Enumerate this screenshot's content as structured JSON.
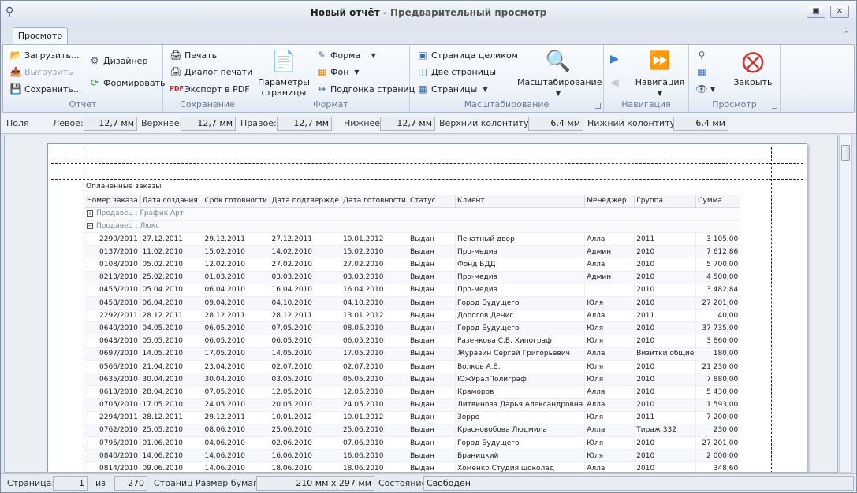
{
  "window": {
    "title": "Новый отчёт",
    "subtitle": " - Предварительный просмотр"
  },
  "tabs": [
    {
      "label": "Просмотр"
    }
  ],
  "ribbon": {
    "report": {
      "title": "Отчет",
      "load": "Загрузить...",
      "unload": "Выгрузить",
      "save": "Сохранить...",
      "designer": "Дизайнер",
      "build": "Формировать"
    },
    "save_group": {
      "title": "Сохранение",
      "print": "Печать",
      "print_dialog": "Диалог печати",
      "export_pdf": "Экспорт в PDF"
    },
    "format": {
      "title": "Формат",
      "page_params": "Параметры страницы",
      "format": "Формат",
      "background": "Фон",
      "fit_pages": "Подгонка страниц"
    },
    "zoom": {
      "title": "Масштабирование",
      "whole_page": "Страница целиком",
      "two_pages": "Две страницы",
      "pages": "Страницы",
      "zoom": "Масштабирование"
    },
    "nav": {
      "title": "Навигация",
      "navigation": "Навигация"
    },
    "view": {
      "title": "Просмотр",
      "close": "Закрыть"
    }
  },
  "margins": {
    "label": "Поля",
    "left_label": "Левое:",
    "left": "12,7 мм",
    "top_label": "Верхнее:",
    "top": "12,7 мм",
    "right_label": "Правое:",
    "right": "12,7 мм",
    "bottom_label": "Нижнее:",
    "bottom": "12,7 мм",
    "header_label": "Верхний колонтитул:",
    "header": "6,4 мм",
    "footer_label": "Нижний колонтитул:",
    "footer": "6,4 мм"
  },
  "report": {
    "title": "Оплаченные заказы",
    "columns": [
      "Номер заказа",
      "Дата создания",
      "Срок готовности",
      "Дата подтвержде",
      "Дата готовности",
      "Статус",
      "Клиент",
      "Менеджер",
      "Группа",
      "Сумма"
    ],
    "group1": "Продавец : График Арт",
    "group2": "Продавец : Люкс",
    "rows": [
      [
        "2290/2011",
        "27.12.2011",
        "29.12.2011",
        "27.12.2011",
        "10.01.2012",
        "Выдан",
        "Печатный двор",
        "Алла",
        "2011",
        "3 105,00"
      ],
      [
        "0137/2010",
        "11.02.2010",
        "15.02.2010",
        "14.02.2010",
        "15.02.2010",
        "Выдан",
        "Про-медиа",
        "Админ",
        "2010",
        "7 612,86"
      ],
      [
        "0108/2010",
        "05.02.2010",
        "12.02.2010",
        "27.02.2010",
        "27.02.2010",
        "Выдан",
        "Фонд БДД",
        "Алла",
        "2010",
        "5 700,00"
      ],
      [
        "0213/2010",
        "25.02.2010",
        "01.03.2010",
        "03.03.2010",
        "03.03.2010",
        "Выдан",
        "Про-медиа",
        "Админ",
        "2010",
        "4 500,00"
      ],
      [
        "0455/2010",
        "05.04.2010",
        "06.04.2010",
        "16.04.2010",
        "16.04.2010",
        "Выдан",
        "Про-медиа",
        "",
        "2010",
        "3 482,84"
      ],
      [
        "0458/2010",
        "06.04.2010",
        "09.04.2010",
        "04.10.2010",
        "04.10.2010",
        "Выдан",
        "Город Будущего",
        "Юля",
        "2010",
        "27 201,00"
      ],
      [
        "2292/2011",
        "28.12.2011",
        "28.12.2011",
        "28.12.2011",
        "13.01.2012",
        "Выдан",
        "Дорогов Денис",
        "Алла",
        "2011",
        "40,00"
      ],
      [
        "0640/2010",
        "04.05.2010",
        "06.05.2010",
        "07.05.2010",
        "08.05.2010",
        "Выдан",
        "Город Будущего",
        "Юля",
        "2010",
        "37 735,00"
      ],
      [
        "0643/2010",
        "05.05.2010",
        "06.05.2010",
        "06.05.2010",
        "06.05.2010",
        "Выдан",
        "Разенкова   С.В. Хипограф",
        "Юля",
        "2010",
        "3 860,00"
      ],
      [
        "0697/2010",
        "14.05.2010",
        "17.05.2010",
        "14.05.2010",
        "17.05.2010",
        "Выдан",
        "Журавин Сергей Григорьевич",
        "Алла",
        "Визитки общие",
        "180,00"
      ],
      [
        "0566/2010",
        "21.04.2010",
        "23.04.2010",
        "02.07.2010",
        "02.07.2010",
        "Выдан",
        "Волков А.Б.",
        "Юля",
        "2010",
        "21 230,00"
      ],
      [
        "0635/2010",
        "30.04.2010",
        "30.04.2010",
        "03.05.2010",
        "05.05.2010",
        "Выдан",
        "ЮжУралПолиграф",
        "Юля",
        "2010",
        "7 880,00"
      ],
      [
        "0613/2010",
        "28.04.2010",
        "07.05.2010",
        "12.05.2010",
        "12.05.2010",
        "Выдан",
        "Краморов",
        "Алла",
        "2010",
        "5 430,00"
      ],
      [
        "0705/2010",
        "17.05.2010",
        "24.05.2010",
        "20.05.2010",
        "24.05.2010",
        "Выдан",
        "Литвинова Дарья Александровна",
        "Алла",
        "2010",
        "1 593,00"
      ],
      [
        "2294/2011",
        "28.12.2011",
        "29.12.2011",
        "10.01.2012",
        "10.01.2012",
        "Выдан",
        "Зорро",
        "Юля",
        "2011",
        "7 200,00"
      ],
      [
        "0762/2010",
        "25.05.2010",
        "08.06.2010",
        "25.06.2010",
        "25.06.2010",
        "Выдан",
        "Красновобова Людмила",
        "Алла",
        "Тираж 332",
        "230,00"
      ],
      [
        "0795/2010",
        "01.06.2010",
        "04.06.2010",
        "02.06.2010",
        "07.06.2010",
        "Выдан",
        "Город Будущего",
        "Юля",
        "2010",
        "27 201,00"
      ],
      [
        "0840/2010",
        "14.06.2010",
        "14.06.2010",
        "16.06.2010",
        "16.06.2010",
        "Выдан",
        "Браницкий",
        "Юля",
        "2010",
        "2 000,00"
      ],
      [
        "0814/2010",
        "09.06.2010",
        "14.06.2010",
        "18.06.2010",
        "18.06.2010",
        "Выдан",
        "Хоменко Студия шоколад",
        "Алла",
        "2010",
        "348,60"
      ]
    ]
  },
  "status": {
    "page_label": "Страница:",
    "page": "1",
    "of_label": "из",
    "total": "270",
    "pages_label": "Страниц",
    "paper_label": "Размер бумаги",
    "paper": "210 мм x 297 мм",
    "state_label": "Состояние",
    "state": "Свободен"
  },
  "colors": {
    "accent": "#3b6cb0",
    "close": "#d0342c"
  }
}
